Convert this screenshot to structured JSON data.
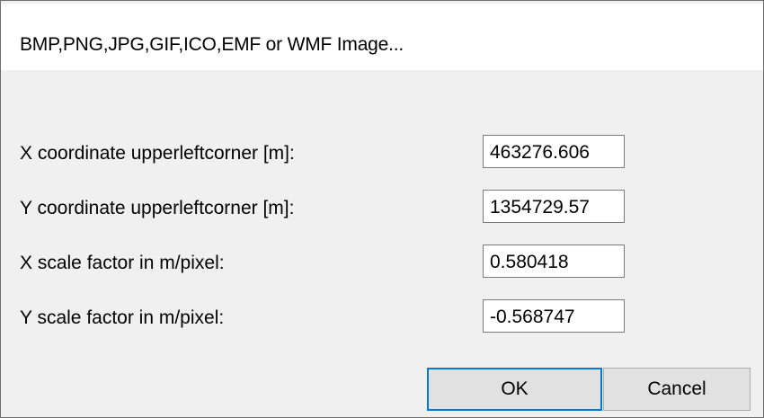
{
  "window": {
    "title": "BMP,PNG,JPG,GIF,ICO,EMF or WMF Image..."
  },
  "fields": [
    {
      "label": "X coordinate upperleftcorner [m]:",
      "value": "463276.606"
    },
    {
      "label": "Y coordinate upperleftcorner [m]:",
      "value": "1354729.57"
    },
    {
      "label": "X scale factor in m/pixel:",
      "value": "0.580418"
    },
    {
      "label": "Y scale factor in m/pixel:",
      "value": "-0.568747"
    }
  ],
  "buttons": {
    "ok_label": "OK",
    "cancel_label": "Cancel"
  },
  "colors": {
    "dialog_background": "#f0f0f0",
    "title_background": "#ffffff",
    "default_button_border": "#0078d7"
  }
}
